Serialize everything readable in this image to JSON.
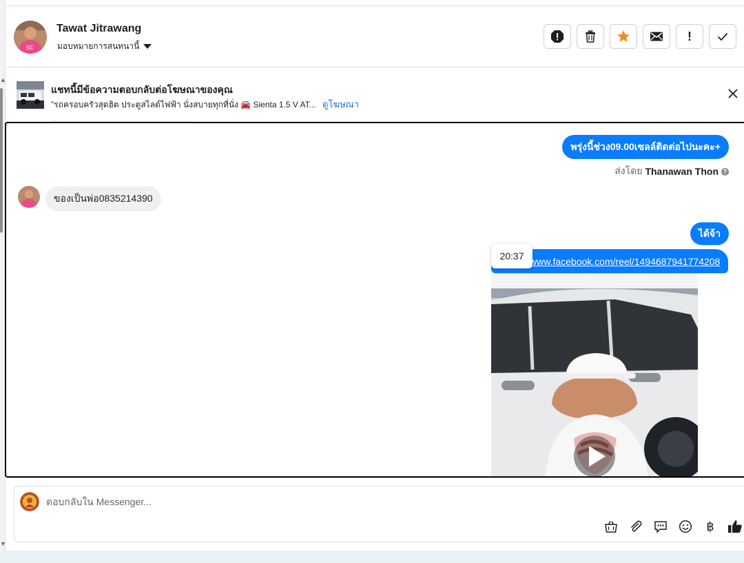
{
  "contact": {
    "name": "Tawat Jitrawang",
    "assign_label": "มอบหมายการสนทนานี้"
  },
  "toolbar": {
    "buttons": [
      "report-icon",
      "trash-icon",
      "star-icon",
      "envelope-icon",
      "exclamation-icon",
      "check-icon"
    ],
    "star_color": "#f5871f",
    "exclamation_label": "!"
  },
  "ad_banner": {
    "title": "แชทนี้มีข้อความตอบกลับต่อโฆษณาของคุณ",
    "snippet": "\"รถครอบครัวสุดฮิต ประตูสไลด์ไฟฟ้า นั่งสบายทุกที่นั่ง 🚘 Sienta 1.5 V AT...",
    "link_label": "ดูโฆษณา"
  },
  "messages": {
    "msg1": "พรุ่งนี้ช่วง09.00เซลล์ติดต่อไปนะคะ+",
    "sent_by_prefix": "ส่งโดย",
    "sent_by_name": "Thanawan Thon",
    "msg2": "ของเป็นพ่อ0835214390",
    "msg3": "ได้จ้า",
    "link_text": "www.facebook.com/reel/1494687941774208",
    "tooltip_time": "20:37"
  },
  "composer": {
    "placeholder": "ตอบกลับใน Messenger...",
    "tools": [
      "bag-icon",
      "paperclip-icon",
      "saved-reply-icon",
      "emoji-icon",
      "baht-icon",
      "thumbs-up-icon"
    ],
    "baht_symbol": "฿"
  },
  "colors": {
    "accent": "#0a7cff",
    "link": "#216fdb",
    "incoming_bubble": "#f0f0f0"
  }
}
